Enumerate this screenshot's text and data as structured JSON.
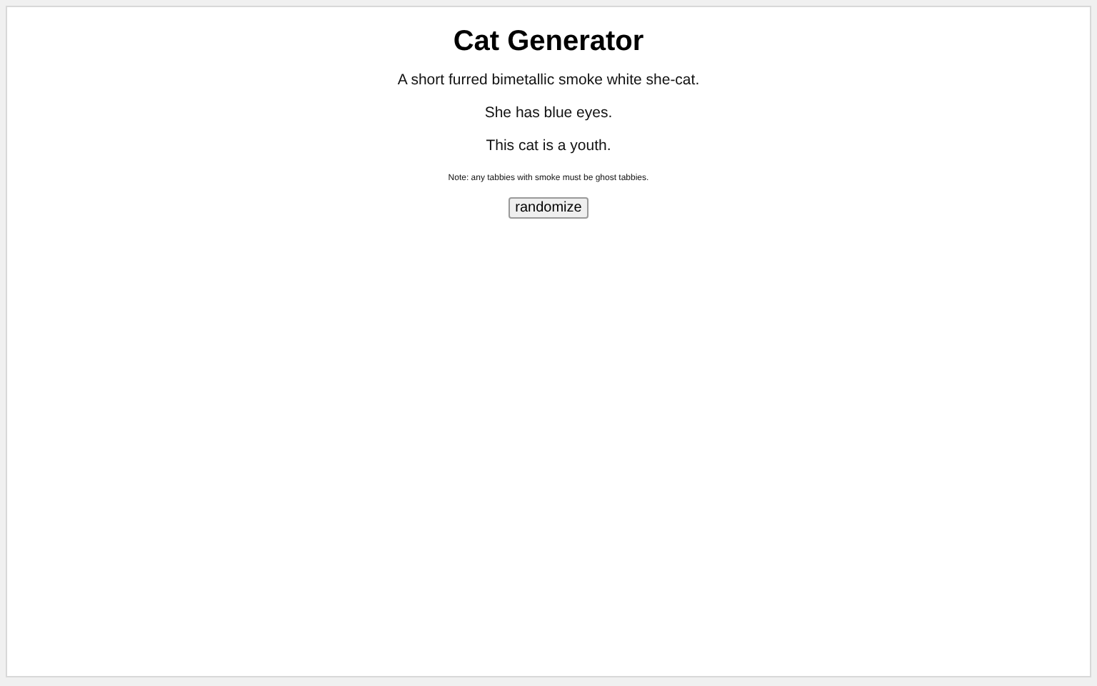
{
  "title": "Cat Generator",
  "description": [
    "A short furred bimetallic smoke white she-cat.",
    "She has blue eyes.",
    "This cat is a youth."
  ],
  "note": "Note: any tabbies with smoke must be ghost tabbies.",
  "button": "randomize"
}
